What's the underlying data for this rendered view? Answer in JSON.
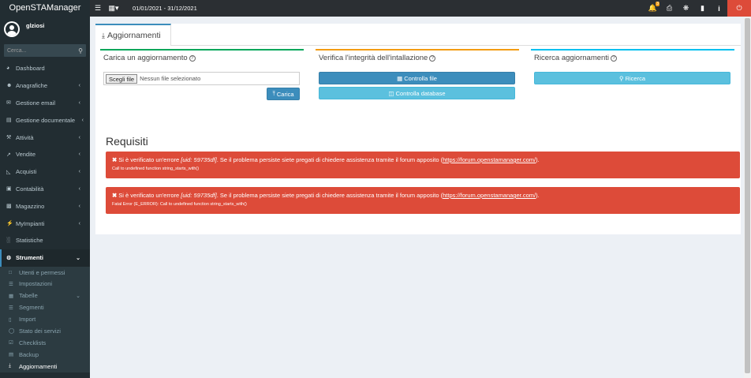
{
  "app": {
    "title": "OpenSTAManager"
  },
  "header": {
    "menu_icon": "hamburger-icon",
    "calendar_icon": "calendar-icon",
    "date_range": "01/01/2021 - 31/12/2021",
    "notification_count": "3",
    "icons": [
      "bell-icon",
      "print-icon",
      "bug-icon",
      "book-icon",
      "info-icon",
      "power-icon"
    ],
    "accent_color": "#dd4b39"
  },
  "sidebar": {
    "username": "glziosi",
    "search_placeholder": "Cerca...",
    "items": [
      {
        "label": "Dashboard",
        "icon": "dashboard-icon",
        "arrow": ""
      },
      {
        "label": "Anagrafiche",
        "icon": "user-icon",
        "arrow": "‹"
      },
      {
        "label": "Gestione email",
        "icon": "envelope-icon",
        "arrow": "‹"
      },
      {
        "label": "Gestione documentale",
        "icon": "document-icon",
        "arrow": "‹"
      },
      {
        "label": "Attività",
        "icon": "wrench-icon",
        "arrow": "‹"
      },
      {
        "label": "Vendite",
        "icon": "chart-icon",
        "arrow": "‹"
      },
      {
        "label": "Acquisti",
        "icon": "cart-icon",
        "arrow": "‹"
      },
      {
        "label": "Contabilità",
        "icon": "briefcase-icon",
        "arrow": "‹"
      },
      {
        "label": "Magazzino",
        "icon": "truck-icon",
        "arrow": "‹"
      },
      {
        "label": "MyImpianti",
        "icon": "plug-icon",
        "arrow": "‹"
      },
      {
        "label": "Statistiche",
        "icon": "bar-chart-icon",
        "arrow": ""
      },
      {
        "label": "Strumenti",
        "icon": "cog-icon",
        "arrow": "⌄"
      }
    ],
    "subitems": [
      {
        "label": "Utenti e permessi",
        "icon": "lock-icon",
        "arrow": ""
      },
      {
        "label": "Impostazioni",
        "icon": "list-icon",
        "arrow": ""
      },
      {
        "label": "Tabelle",
        "icon": "table-icon",
        "arrow": "⌄"
      },
      {
        "label": "Segmenti",
        "icon": "list-icon",
        "arrow": ""
      },
      {
        "label": "Import",
        "icon": "file-icon",
        "arrow": ""
      },
      {
        "label": "Stato dei servizi",
        "icon": "globe-icon",
        "arrow": ""
      },
      {
        "label": "Checklists",
        "icon": "check-square-icon",
        "arrow": ""
      },
      {
        "label": "Backup",
        "icon": "archive-icon",
        "arrow": ""
      },
      {
        "label": "Aggiornamenti",
        "icon": "download-icon",
        "arrow": ""
      }
    ]
  },
  "main": {
    "tab_label": "Aggiornamenti",
    "boxes": {
      "upload": {
        "title": "Carica un aggiornamento",
        "file_button": "Scegli file",
        "file_status": "Nessun file selezionato",
        "submit_label": "Carica",
        "border_color": "#00a65a"
      },
      "integrity": {
        "title": "Verifica l'integrità dell'intallazione",
        "check_files_label": "Controlla file",
        "check_db_label": "Controlla database",
        "border_color": "#f39c12"
      },
      "search": {
        "title": "Ricerca aggiornamenti",
        "search_label": "Ricerca",
        "border_color": "#00c0ef"
      }
    },
    "requirements": {
      "title": "Requisiti",
      "alerts": [
        {
          "message_pre": "Si è verificato un'errore ",
          "uid": "[uid: 59735df]",
          "message_post": ". Se il problema persiste siete pregati di chiedere assistenza tramite il forum apposito (",
          "link": "https://forum.openstamanager.com/",
          "message_end": ").",
          "detail": "Call to undefined function string_starts_with()"
        },
        {
          "message_pre": "Si è verificato un'errore ",
          "uid": "[uid: 59735df]",
          "message_post": ". Se il problema persiste siete pregati di chiedere assistenza tramite il forum apposito (",
          "link": "https://forum.openstamanager.com/",
          "message_end": ").",
          "detail": "Fatal Error (E_ERROR): Call to undefined function string_starts_with()"
        }
      ]
    }
  }
}
